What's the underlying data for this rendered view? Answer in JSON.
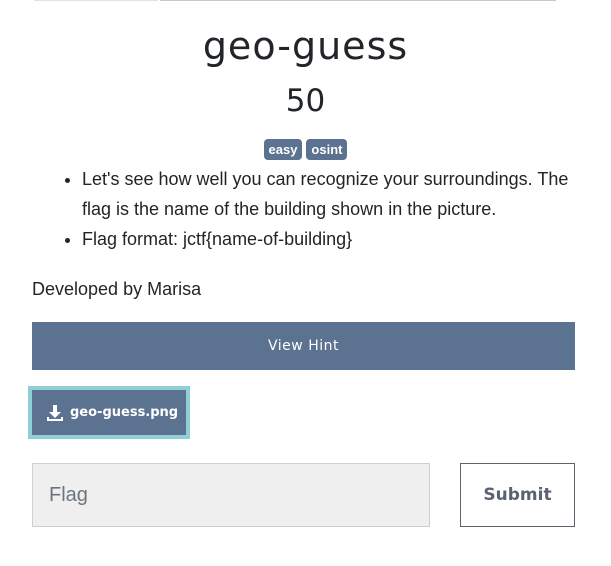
{
  "challenge": {
    "title": "geo-guess",
    "points": "50",
    "tags": [
      "easy",
      "osint"
    ],
    "description_items": [
      "Let's see how well you can recognize your surroundings. The flag is the name of the building shown in the picture.",
      "Flag format: jctf{name-of-building}"
    ],
    "developer": "Developed by Marisa"
  },
  "actions": {
    "hint_label": "View Hint",
    "file_label": "geo-guess.png",
    "file_icon": "download-icon",
    "flag_placeholder": "Flag",
    "flag_value": "",
    "submit_label": "Submit"
  },
  "colors": {
    "accent": "#5b7290",
    "file_focus_ring": "#8fcfd8",
    "input_bg": "#efefef"
  }
}
